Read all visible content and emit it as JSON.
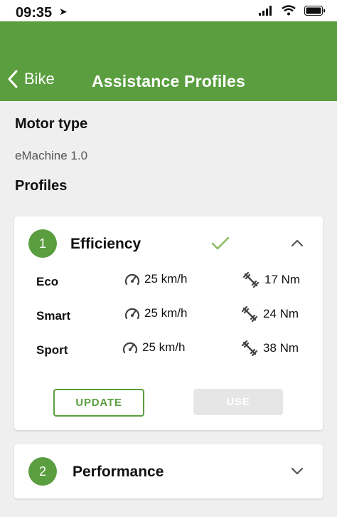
{
  "status": {
    "time": "09:35"
  },
  "nav": {
    "back_label": "Bike",
    "title": "Assistance Profiles"
  },
  "motor": {
    "heading": "Motor type",
    "value": "eMachine 1.0"
  },
  "profiles_heading": "Profiles",
  "profiles": [
    {
      "number": "1",
      "name": "Efficiency",
      "selected": true,
      "expanded": true,
      "rows": [
        {
          "name": "Eco",
          "speed": "25 km/h",
          "torque": "17 Nm"
        },
        {
          "name": "Smart",
          "speed": "25 km/h",
          "torque": "24 Nm"
        },
        {
          "name": "Sport",
          "speed": "25 km/h",
          "torque": "38 Nm"
        }
      ],
      "update_label": "UPDATE",
      "use_label": "USE"
    },
    {
      "number": "2",
      "name": "Performance",
      "selected": false,
      "expanded": false
    }
  ],
  "colors": {
    "accent": "#5a9e3f",
    "check": "#8bbd63"
  },
  "icons": {
    "speed": "speedometer-icon",
    "torque": "torque-wrench-icon"
  }
}
